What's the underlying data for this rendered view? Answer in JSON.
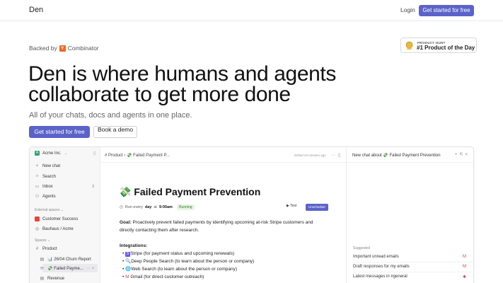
{
  "nav": {
    "brand": "Den",
    "login": "Login",
    "cta": "Get started for free"
  },
  "backed": {
    "prefix": "Backed by",
    "yc_letter": "Y",
    "yc_word": "Combinator"
  },
  "product_hunt": {
    "small": "PRODUCT HUNT",
    "big": "#1 Product of the Day"
  },
  "hero": {
    "line1": "Den is where humans and agents",
    "line2": "collaborate to get more done",
    "subtitle": "All of your chats, docs and agents in one place.",
    "primary_cta": "Get started for free",
    "secondary_cta": "Book a demo"
  },
  "app": {
    "sidebar": {
      "workspace": "Acme Inc.",
      "items": [
        {
          "icon": "+",
          "label": "New chat"
        },
        {
          "icon": "⌕",
          "label": "Search"
        },
        {
          "icon": "▭",
          "label": "Inbox",
          "badge": "3"
        },
        {
          "icon": "⚇",
          "label": "Agents"
        }
      ],
      "external_label": "External spaces",
      "external": [
        {
          "label": "Customer Success"
        },
        {
          "label": "Bauhaus / Acme"
        }
      ],
      "spaces_label": "Spaces",
      "spaces": [
        {
          "icon": "#",
          "label": "Product"
        },
        {
          "label": "📊 26/04 Churn Report"
        },
        {
          "label": "💸 Failed Payme..."
        },
        {
          "label": "Revenue"
        }
      ]
    },
    "main": {
      "breadcrumb": "# Product  ›  💸 Failed Payment P...",
      "edited": "Edited 34 minutes ago",
      "title": "💸 Failed Payment Prevention",
      "run_prefix": "Run every",
      "run_day": "day",
      "run_at": "at",
      "run_time": "9:00am",
      "status": "Running",
      "test": "▶ Test",
      "unschedule": "Unschedule",
      "goal_label": "Goal:",
      "goal_text": "Proactively prevent failed payments by identifying upcoming at-risk Stripe customers and",
      "goal_text2": "directly contacting them after research.",
      "integrations_label": "Integrations:",
      "integrations": [
        "Stripe (for payment status and upcoming renewals)",
        "Deep People Search (to learn about the person or company)",
        "Web Search (to learn about the person or company)",
        "Gmail (for direct customer outreach)"
      ]
    },
    "chat": {
      "title": "New chat about 💸 Failed Payment Prevention",
      "suggested_label": "Suggested",
      "suggestions": [
        "Important unread emails",
        "Draft responses for my emails",
        "Latest messages in #general"
      ]
    }
  },
  "colors": {
    "accent": "#5b63c9",
    "yc": "#f26522"
  }
}
